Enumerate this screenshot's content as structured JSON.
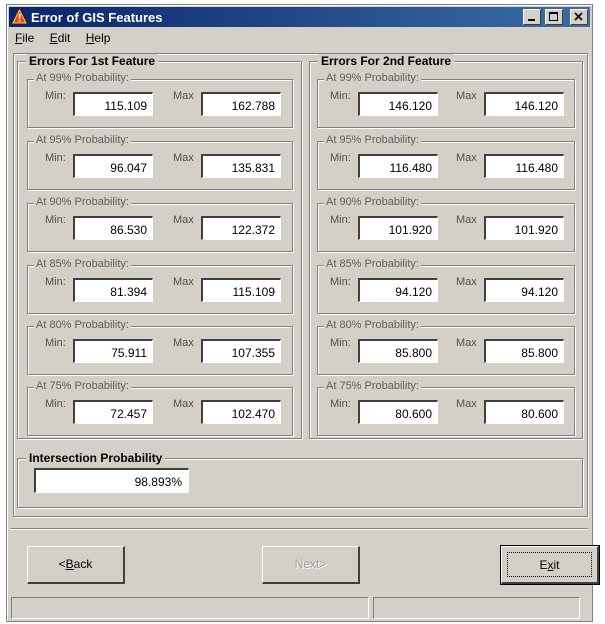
{
  "window": {
    "title": "Error of GIS Features",
    "icon": "warning-triangle-icon",
    "controls": [
      "minimize-icon",
      "maximize-icon",
      "close-icon"
    ]
  },
  "menu": [
    {
      "label": "File",
      "mnemonic": "F"
    },
    {
      "label": "Edit",
      "mnemonic": "E"
    },
    {
      "label": "Help",
      "mnemonic": "H"
    }
  ],
  "feature1": {
    "title": "Errors For 1st Feature",
    "groups": [
      {
        "label": "At 99% Probability:",
        "min_label": "Min:",
        "max_label": "Max",
        "min": "115.109",
        "max": "162.788"
      },
      {
        "label": "At 95% Probability:",
        "min_label": "Min:",
        "max_label": "Max",
        "min": "96.047",
        "max": "135.831"
      },
      {
        "label": "At 90% Probability:",
        "min_label": "Min:",
        "max_label": "Max",
        "min": "86.530",
        "max": "122.372"
      },
      {
        "label": "At 85% Probability:",
        "min_label": "Min:",
        "max_label": "Max",
        "min": "81.394",
        "max": "115.109"
      },
      {
        "label": "At 80% Probability:",
        "min_label": "Min:",
        "max_label": "Max",
        "min": "75.911",
        "max": "107.355"
      },
      {
        "label": "At 75% Probability:",
        "min_label": "Min:",
        "max_label": "Max",
        "min": "72.457",
        "max": "102.470"
      }
    ]
  },
  "feature2": {
    "title": "Errors For 2nd Feature",
    "groups": [
      {
        "label": "At 99% Probability:",
        "min_label": "Min:",
        "max_label": "Max",
        "min": "146.120",
        "max": "146.120"
      },
      {
        "label": "At 95% Probability:",
        "min_label": "Min:",
        "max_label": "Max",
        "min": "116.480",
        "max": "116.480"
      },
      {
        "label": "At 90% Probability:",
        "min_label": "Min:",
        "max_label": "Max",
        "min": "101.920",
        "max": "101.920"
      },
      {
        "label": "At 85% Probability:",
        "min_label": "Min:",
        "max_label": "Max",
        "min": "94.120",
        "max": "94.120"
      },
      {
        "label": "At 80% Probability:",
        "min_label": "Min:",
        "max_label": "Max",
        "min": "85.800",
        "max": "85.800"
      },
      {
        "label": "At 75% Probability:",
        "min_label": "Min:",
        "max_label": "Max",
        "min": "80.600",
        "max": "80.600"
      }
    ]
  },
  "intersection": {
    "title": "Intersection Probability",
    "value": "98.893%"
  },
  "buttons": {
    "back": {
      "prefix": "<",
      "mnemonic": "B",
      "rest": "ack"
    },
    "next": {
      "label": "Next>",
      "disabled": true
    },
    "exit": {
      "prefix": "E",
      "mnemonic": "x",
      "rest": "it"
    }
  },
  "colors": {
    "titlebar_start": "#0a246a",
    "titlebar_end": "#3a6ea5",
    "face": "#d4d0c8"
  }
}
